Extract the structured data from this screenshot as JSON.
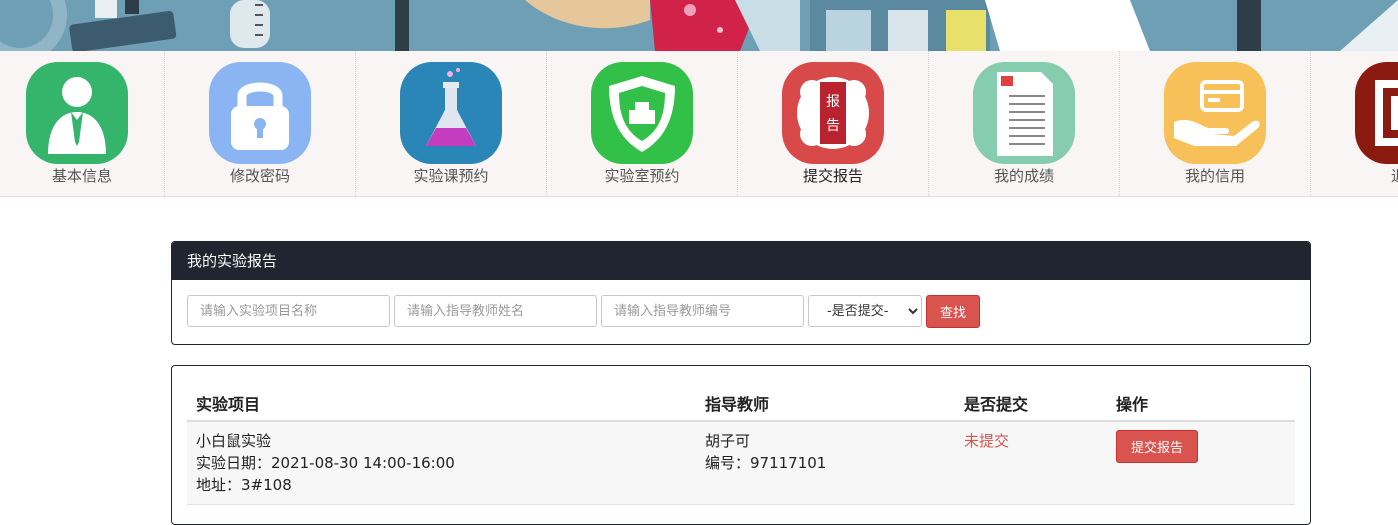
{
  "nav": [
    {
      "label": "基本信息",
      "icon": "user-icon",
      "color": "#35b56b",
      "active": false
    },
    {
      "label": "修改密码",
      "icon": "lock-icon",
      "color": "#8bb4f2",
      "active": false
    },
    {
      "label": "实验课预约",
      "icon": "flask-icon",
      "color": "#2b86b8",
      "active": false
    },
    {
      "label": "实验室预约",
      "icon": "shield-icon",
      "color": "#33c049",
      "active": false
    },
    {
      "label": "提交报告",
      "icon": "report-icon",
      "color": "#d84a4a",
      "active": true
    },
    {
      "label": "我的成绩",
      "icon": "document-icon",
      "color": "#86cdb0",
      "active": false
    },
    {
      "label": "我的信用",
      "icon": "credit-card-hand-icon",
      "color": "#f7c058",
      "active": false
    },
    {
      "label": "退出",
      "icon": "logout-icon",
      "color": "#8b1a10",
      "active": false
    }
  ],
  "report_icon_text": [
    "报",
    "告"
  ],
  "search": {
    "title": "我的实验报告",
    "project_placeholder": "请输入实验项目名称",
    "teacher_name_placeholder": "请输入指导教师姓名",
    "teacher_id_placeholder": "请输入指导教师编号",
    "submitted_select": "-是否提交-",
    "search_button": "查找"
  },
  "table": {
    "headers": [
      "实验项目",
      "指导教师",
      "是否提交",
      "操作"
    ],
    "rows": [
      {
        "project": "小白鼠实验",
        "date": "实验日期：2021-08-30 14:00-16:00",
        "address": "地址：3#108",
        "teacher": "胡子可",
        "teacher_id": "编号：97117101",
        "status": "未提交",
        "action": "提交报告"
      }
    ]
  },
  "colors": {
    "header_dark": "#1f262f",
    "button_red": "#d9534f",
    "banner_blue": "#6e9fb5"
  }
}
